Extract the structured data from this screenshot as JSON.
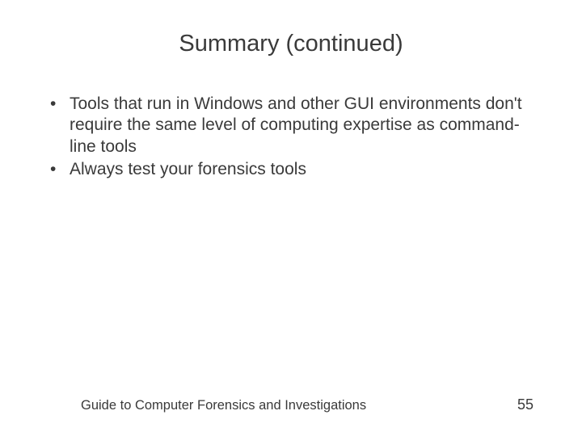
{
  "title": "Summary (continued)",
  "bullets": [
    "Tools that run in Windows and other GUI environments don't require the same level of computing expertise as command-line tools",
    "Always test your forensics tools"
  ],
  "footer": {
    "text": "Guide to Computer Forensics and Investigations",
    "page": "55"
  }
}
